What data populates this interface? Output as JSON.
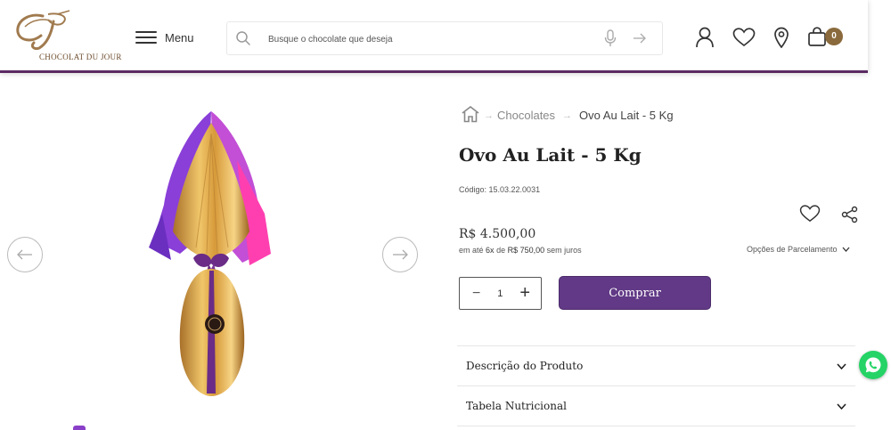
{
  "brand": {
    "name": "CHOCOLAT DU JOUR",
    "logo_icon": "cj-monogram-logo",
    "color_gold": "#8a6a3c",
    "color_purple": "#613986"
  },
  "header": {
    "menu_label": "Menu",
    "search_placeholder": "Busque o chocolate que deseja",
    "cart_count": "0",
    "icons": [
      "hamburger-icon",
      "search-icon",
      "microphone-icon",
      "arrow-right-icon",
      "user-icon",
      "heart-icon",
      "location-pin-icon",
      "shopping-bag-icon"
    ]
  },
  "breadcrumb": {
    "home_icon": "home-icon",
    "sep": "→",
    "category": "Chocolates",
    "current": "Ovo Au Lait - 5 Kg"
  },
  "product": {
    "title": "Ovo Au Lait - 5 Kg",
    "code": "Código: 15.03.22.0031",
    "price": "R$ 4.500,00",
    "installments_prefix": "em até",
    "installments_count": "6x",
    "installments_de": "de",
    "installments_value": "R$ 750,00",
    "installments_suffix": "sem juros",
    "installment_options_label": "Opções de Parcelamento",
    "quantity": "1",
    "quantity_minus": "−",
    "quantity_plus": "+",
    "buy_label": "Comprar"
  },
  "accordion": [
    {
      "label": "Descrição do Produto"
    },
    {
      "label": "Tabela Nutricional"
    }
  ],
  "floating": {
    "whatsapp_icon": "whatsapp-icon"
  }
}
